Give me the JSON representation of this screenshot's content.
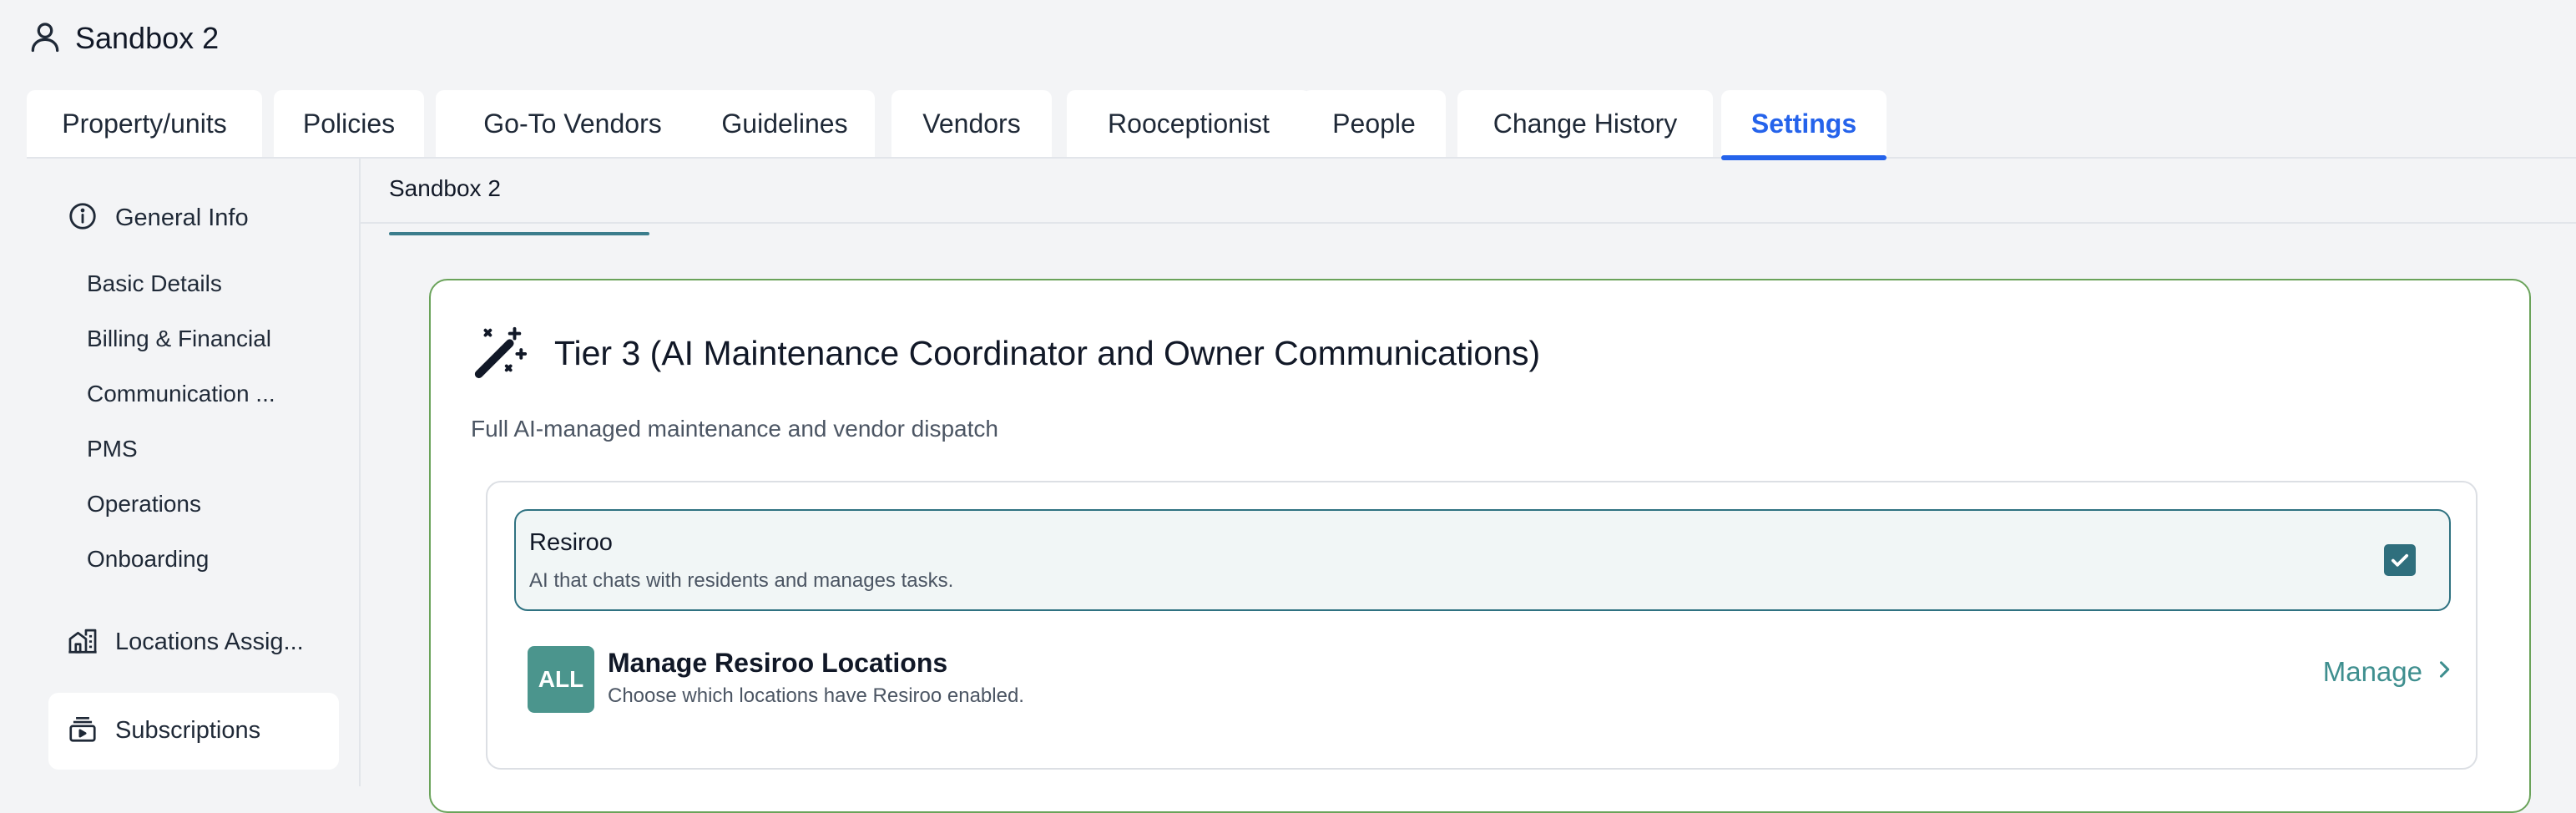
{
  "header": {
    "title": "Sandbox 2",
    "icon": "user-icon"
  },
  "tabs": [
    {
      "label": "Property/units"
    },
    {
      "label": "Policies"
    },
    {
      "label": "Go-To Vendors"
    },
    {
      "label": "Guidelines"
    },
    {
      "label": "Vendors"
    },
    {
      "label": "Rooceptionist"
    },
    {
      "label": "People"
    },
    {
      "label": "Change History"
    },
    {
      "label": "Settings",
      "active": true
    }
  ],
  "sidebar": {
    "general": {
      "label": "General Info",
      "icon": "info-icon"
    },
    "sub_items": [
      {
        "label": "Basic Details"
      },
      {
        "label": "Billing & Financial"
      },
      {
        "label": "Communication ..."
      },
      {
        "label": "PMS"
      },
      {
        "label": "Operations"
      },
      {
        "label": "Onboarding"
      }
    ],
    "locations": {
      "label": "Locations Assig...",
      "icon": "building-icon"
    },
    "subscriptions": {
      "label": "Subscriptions",
      "icon": "subscriptions-icon",
      "active": true
    }
  },
  "subtab": {
    "label": "Sandbox 2"
  },
  "tier": {
    "title": "Tier 3 (AI Maintenance Coordinator and Owner Communications)",
    "description": "Full AI-managed maintenance and vendor dispatch",
    "icon": "magic-wand-icon",
    "product": {
      "name": "Resiroo",
      "description": "AI that chats with residents and manages tasks.",
      "checked": true
    },
    "locations": {
      "badge": "ALL",
      "title": "Manage Resiroo Locations",
      "description": "Choose which locations have Resiroo enabled.",
      "link": "Manage"
    }
  },
  "colors": {
    "accent": "#2563eb",
    "teal": "#2f7281",
    "card_border": "#6aa35a",
    "badge": "#4b958d"
  }
}
